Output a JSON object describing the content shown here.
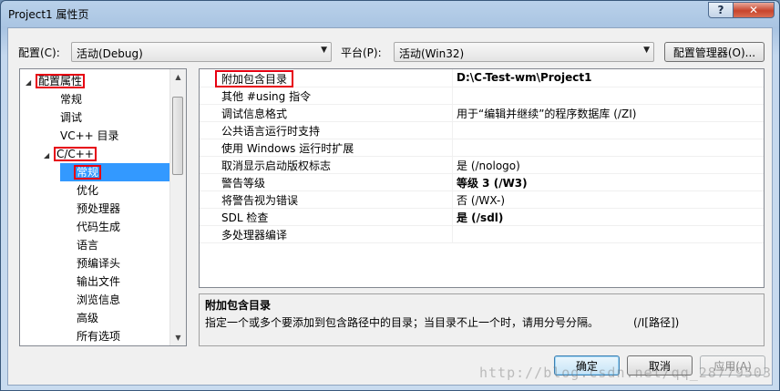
{
  "window": {
    "title": "Project1 属性页",
    "help_label": "?",
    "close_label": "✕"
  },
  "config": {
    "label": "配置(C):",
    "value": "活动(Debug)"
  },
  "platform": {
    "label": "平台(P):",
    "value": "活动(Win32)"
  },
  "buttons": {
    "config_manager": "配置管理器(O)...",
    "ok": "确定",
    "cancel": "取消",
    "apply": "应用(A)"
  },
  "tree": {
    "items": [
      {
        "label": "配置属性",
        "expander": "◢"
      },
      {
        "label": "常规"
      },
      {
        "label": "调试"
      },
      {
        "label": "VC++ 目录"
      },
      {
        "label": "C/C++",
        "expander": "◢"
      },
      {
        "label": "常规"
      },
      {
        "label": "优化"
      },
      {
        "label": "预处理器"
      },
      {
        "label": "代码生成"
      },
      {
        "label": "语言"
      },
      {
        "label": "预编译头"
      },
      {
        "label": "输出文件"
      },
      {
        "label": "浏览信息"
      },
      {
        "label": "高级"
      },
      {
        "label": "所有选项"
      }
    ]
  },
  "grid": {
    "rows": [
      {
        "name": "附加包含目录",
        "value": "D:\\C-Test-wm\\Project1"
      },
      {
        "name": "其他 #using 指令",
        "value": ""
      },
      {
        "name": "调试信息格式",
        "value": "用于“编辑并继续”的程序数据库 (/ZI)"
      },
      {
        "name": "公共语言运行时支持",
        "value": ""
      },
      {
        "name": "使用 Windows 运行时扩展",
        "value": ""
      },
      {
        "name": "取消显示启动版权标志",
        "value": "是 (/nologo)"
      },
      {
        "name": "警告等级",
        "value": "等级 3 (/W3)"
      },
      {
        "name": "将警告视为错误",
        "value": "否 (/WX-)"
      },
      {
        "name": "SDL 检查",
        "value": "是 (/sdl)"
      },
      {
        "name": "多处理器编译",
        "value": ""
      }
    ]
  },
  "description": {
    "title": "附加包含目录",
    "body": "指定一个或多个要添加到包含路径中的目录；当目录不止一个时，请用分号分隔。",
    "switch": "(/I[路径])"
  },
  "watermark": "http://blog.csdn.net/qq_28779503",
  "colors": {
    "selection": "#3399ff",
    "highlight_box": "#e60012"
  }
}
